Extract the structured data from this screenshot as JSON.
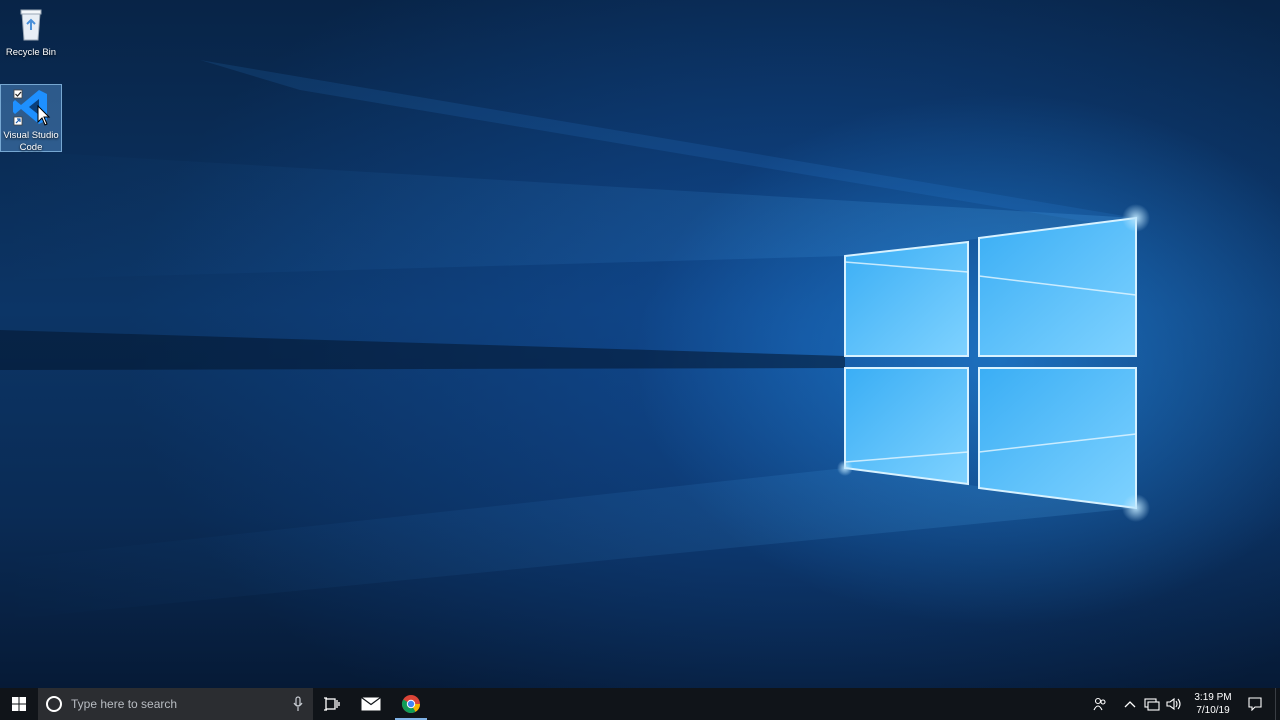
{
  "desktop": {
    "icons": [
      {
        "label": "Recycle Bin",
        "icon": "recycle-bin-icon"
      },
      {
        "label": "Visual Studio Code",
        "icon": "vscode-icon",
        "selected": true
      }
    ]
  },
  "taskbar": {
    "start_icon": "windows-logo-icon",
    "search": {
      "placeholder": "Type here to search",
      "icon": "cortana-circle-icon",
      "mic_icon": "microphone-icon"
    },
    "pinned": [
      {
        "name": "Task View",
        "icon": "task-view-icon"
      },
      {
        "name": "Mail",
        "icon": "mail-icon"
      },
      {
        "name": "Google Chrome",
        "icon": "chrome-icon",
        "active": true
      }
    ],
    "tray_icons": [
      "people-icon",
      "chevron-up-icon",
      "network-icon",
      "volume-icon"
    ],
    "clock": {
      "time": "3:19 PM",
      "date": "7/10/19"
    },
    "action_center_icon": "notification-icon"
  },
  "colors": {
    "taskbar_bg": "#101419",
    "search_bg": "#2b2d31",
    "accent": "#1e90ff"
  }
}
